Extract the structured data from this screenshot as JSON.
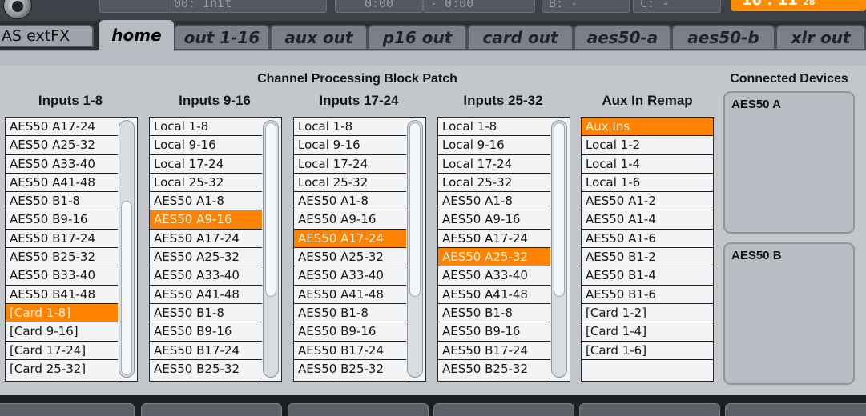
{
  "top": {
    "scene_label": "00: Init",
    "time_a": "0:00",
    "time_b": "- 0:00",
    "slot_b": "B:  -",
    "slot_c": "C:  -",
    "clock": "16 : 11",
    "clock_suffix": "28"
  },
  "bus_label": "AS extFX",
  "tabs": [
    {
      "label": "home",
      "active": true
    },
    {
      "label": "out 1-16",
      "active": false
    },
    {
      "label": "aux out",
      "active": false
    },
    {
      "label": "p16 out",
      "active": false
    },
    {
      "label": "card out",
      "active": false
    },
    {
      "label": "aes50-a",
      "active": false
    },
    {
      "label": "aes50-b",
      "active": false
    },
    {
      "label": "xlr out",
      "active": false
    }
  ],
  "panel": {
    "title": "Channel Processing Block Patch",
    "connected_title": "Connected Devices",
    "devices": [
      "AES50 A",
      "AES50 B"
    ]
  },
  "columns": [
    {
      "title": "Inputs 1-8",
      "items": [
        "AES50 A17-24",
        "AES50 A25-32",
        "AES50 A33-40",
        "AES50 A41-48",
        "AES50 B1-8",
        "AES50 B9-16",
        "AES50 B17-24",
        "AES50 B25-32",
        "AES50 B33-40",
        "AES50 B41-48",
        "[Card 1-8]",
        "[Card 9-16]",
        "[Card 17-24]",
        "[Card 25-32]"
      ],
      "selected": 10,
      "scroll": true,
      "thumb_start": 0.31,
      "thumb_len": 0.69
    },
    {
      "title": "Inputs 9-16",
      "items": [
        "Local 1-8",
        "Local 9-16",
        "Local 17-24",
        "Local 25-32",
        "AES50 A1-8",
        "AES50 A9-16",
        "AES50 A17-24",
        "AES50 A25-32",
        "AES50 A33-40",
        "AES50 A41-48",
        "AES50 B1-8",
        "AES50 B9-16",
        "AES50 B17-24",
        "AES50 B25-32"
      ],
      "selected": 5,
      "scroll": true,
      "thumb_start": 0.0,
      "thumb_len": 0.69
    },
    {
      "title": "Inputs 17-24",
      "items": [
        "Local 1-8",
        "Local 9-16",
        "Local 17-24",
        "Local 25-32",
        "AES50 A1-8",
        "AES50 A9-16",
        "AES50 A17-24",
        "AES50 A25-32",
        "AES50 A33-40",
        "AES50 A41-48",
        "AES50 B1-8",
        "AES50 B9-16",
        "AES50 B17-24",
        "AES50 B25-32"
      ],
      "selected": 6,
      "scroll": true,
      "thumb_start": 0.0,
      "thumb_len": 0.69
    },
    {
      "title": "Inputs 25-32",
      "items": [
        "Local 1-8",
        "Local 9-16",
        "Local 17-24",
        "Local 25-32",
        "AES50 A1-8",
        "AES50 A9-16",
        "AES50 A17-24",
        "AES50 A25-32",
        "AES50 A33-40",
        "AES50 A41-48",
        "AES50 B1-8",
        "AES50 B9-16",
        "AES50 B17-24",
        "AES50 B25-32"
      ],
      "selected": 7,
      "scroll": true,
      "thumb_start": 0.0,
      "thumb_len": 0.69
    },
    {
      "title": "Aux In Remap",
      "items": [
        "Aux Ins",
        "Local 1-2",
        "Local 1-4",
        "Local 1-6",
        "AES50 A1-2",
        "AES50 A1-4",
        "AES50 A1-6",
        "AES50 B1-2",
        "AES50 B1-4",
        "AES50 B1-6",
        "[Card 1-2]",
        "[Card 1-4]",
        "[Card 1-6]",
        ""
      ],
      "selected": 0,
      "scroll": false
    }
  ]
}
